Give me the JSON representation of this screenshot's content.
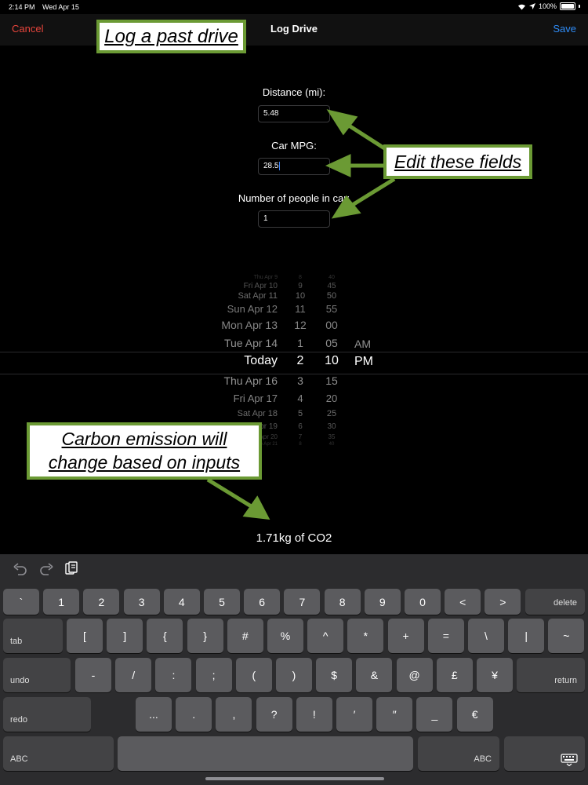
{
  "status": {
    "time": "2:14 PM",
    "date": "Wed Apr 15",
    "battery": "100%"
  },
  "nav": {
    "cancel": "Cancel",
    "title": "Log Drive",
    "save": "Save"
  },
  "annotations": {
    "log_past_drive": "Log a past drive",
    "edit_fields": "Edit these fields",
    "carbon_line1": "Carbon emission will",
    "carbon_line2": "change based on inputs"
  },
  "form": {
    "distance_label": "Distance (mi):",
    "distance_value": "5.48",
    "mpg_label": "Car MPG:",
    "mpg_value": "28.5",
    "people_label": "Number of people in car:",
    "people_value": "1"
  },
  "picker": {
    "days": [
      "Thu Apr 9",
      "Fri Apr 10",
      "Sat Apr 11",
      "Sun Apr 12",
      "Mon Apr 13",
      "Tue Apr 14",
      "Today",
      "Thu Apr 16",
      "Fri Apr 17",
      "Sat Apr 18",
      "Sun Apr 19",
      "Mon Apr 20",
      "Tue Apr 21"
    ],
    "hours": [
      "8",
      "9",
      "10",
      "11",
      "12",
      "1",
      "2",
      "3",
      "4",
      "5",
      "6",
      "7",
      "8"
    ],
    "minutes": [
      "40",
      "45",
      "50",
      "55",
      "00",
      "05",
      "10",
      "15",
      "20",
      "25",
      "30",
      "35",
      "40"
    ],
    "ampm": [
      "AM",
      "PM"
    ],
    "selected": {
      "day": "Today",
      "hour": "2",
      "minute": "10",
      "period": "PM"
    }
  },
  "result": "1.71kg of CO2",
  "keyboard": {
    "row1": [
      "`",
      "1",
      "2",
      "3",
      "4",
      "5",
      "6",
      "7",
      "8",
      "9",
      "0",
      "<",
      ">"
    ],
    "delete": "delete",
    "tab": "tab",
    "row2": [
      "[",
      "]",
      "{",
      "}",
      "#",
      "%",
      "^",
      "*",
      "+",
      "=",
      "\\",
      "|",
      "~"
    ],
    "undo": "undo",
    "row3": [
      "-",
      "/",
      ":",
      ";",
      "(",
      ")",
      "$",
      "&",
      "@",
      "£",
      "¥"
    ],
    "return": "return",
    "redo": "redo",
    "row4": [
      "...",
      ".",
      ",",
      "?",
      "!",
      "′",
      "″",
      "_",
      "€"
    ],
    "abc_left": "ABC",
    "abc_right": "ABC"
  },
  "colors": {
    "cancel": "#e8453c",
    "save": "#2f8cf7",
    "annotation_border": "#6b9a34"
  }
}
